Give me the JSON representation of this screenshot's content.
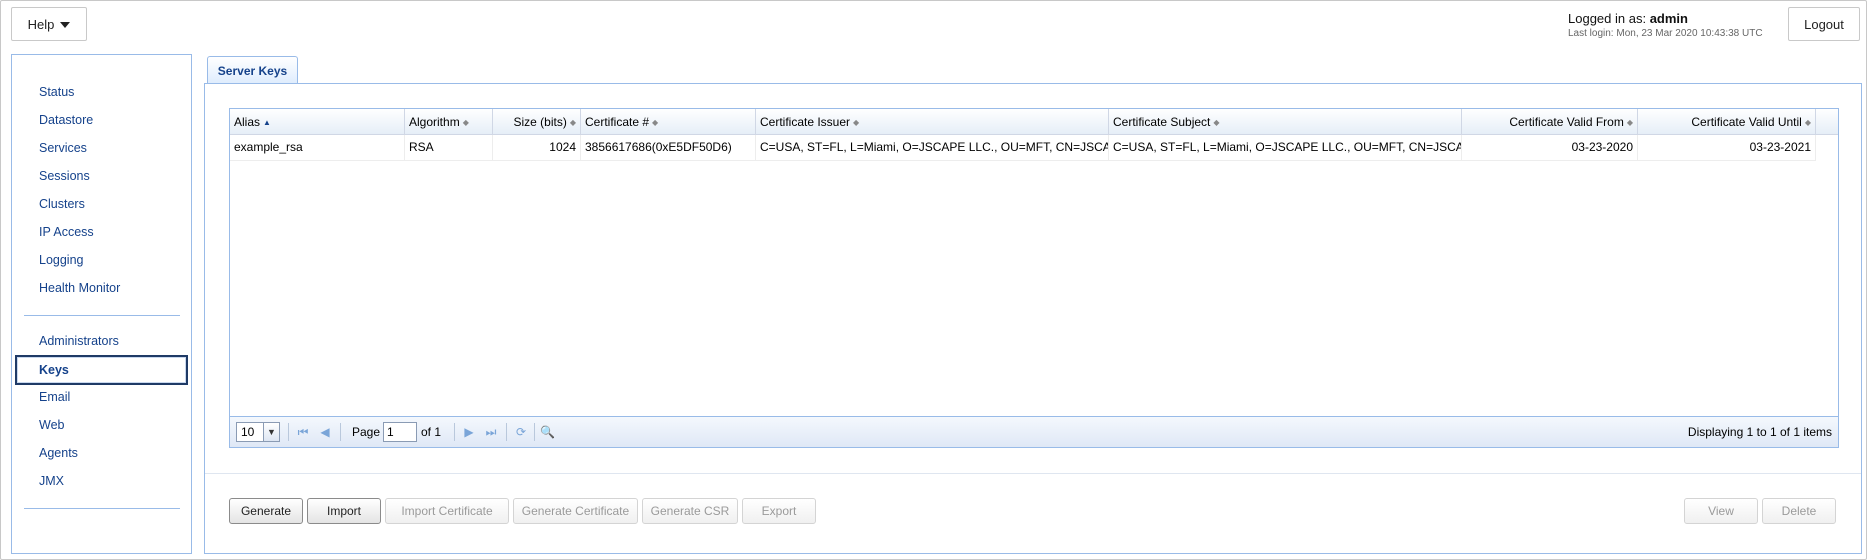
{
  "header": {
    "help_label": "Help",
    "logged_in_prefix": "Logged in as:",
    "username": "admin",
    "last_login": "Last login: Mon, 23 Mar 2020 10:43:38 UTC",
    "logout_label": "Logout"
  },
  "sidebar": {
    "items": [
      {
        "label": "Status"
      },
      {
        "label": "Datastore"
      },
      {
        "label": "Services"
      },
      {
        "label": "Sessions"
      },
      {
        "label": "Clusters"
      },
      {
        "label": "IP Access"
      },
      {
        "label": "Logging"
      },
      {
        "label": "Health Monitor"
      },
      {
        "label": "Administrators"
      },
      {
        "label": "Keys",
        "selected": true
      },
      {
        "label": "Email"
      },
      {
        "label": "Web"
      },
      {
        "label": "Agents"
      },
      {
        "label": "JMX"
      }
    ]
  },
  "tab": {
    "label": "Server Keys"
  },
  "grid": {
    "columns": [
      {
        "label": "Alias",
        "sort": "asc"
      },
      {
        "label": "Algorithm"
      },
      {
        "label": "Size (bits)"
      },
      {
        "label": "Certificate #"
      },
      {
        "label": "Certificate Issuer"
      },
      {
        "label": "Certificate Subject"
      },
      {
        "label": "Certificate Valid From"
      },
      {
        "label": "Certificate Valid Until"
      }
    ],
    "rows": [
      {
        "alias": "example_rsa",
        "algorithm": "RSA",
        "size": "1024",
        "cert_number": "3856617686(0xE5DF50D6)",
        "issuer": "C=USA, ST=FL, L=Miami, O=JSCAPE LLC., OU=MFT, CN=JSCAPE",
        "subject": "C=USA, ST=FL, L=Miami, O=JSCAPE LLC., OU=MFT, CN=JSCAPE",
        "valid_from": "03-23-2020",
        "valid_until": "03-23-2021"
      }
    ]
  },
  "paging": {
    "page_size": "10",
    "page_label": "Page",
    "page_value": "1",
    "of_label": "of 1",
    "displaying": "Displaying 1 to 1 of 1 items"
  },
  "buttons": {
    "generate": "Generate",
    "import": "Import",
    "import_certificate": "Import Certificate",
    "generate_certificate": "Generate Certificate",
    "generate_csr": "Generate CSR",
    "export": "Export",
    "view": "View",
    "delete": "Delete"
  },
  "colors": {
    "accent_text": "#15428b",
    "panel_border": "#99bbe8"
  }
}
